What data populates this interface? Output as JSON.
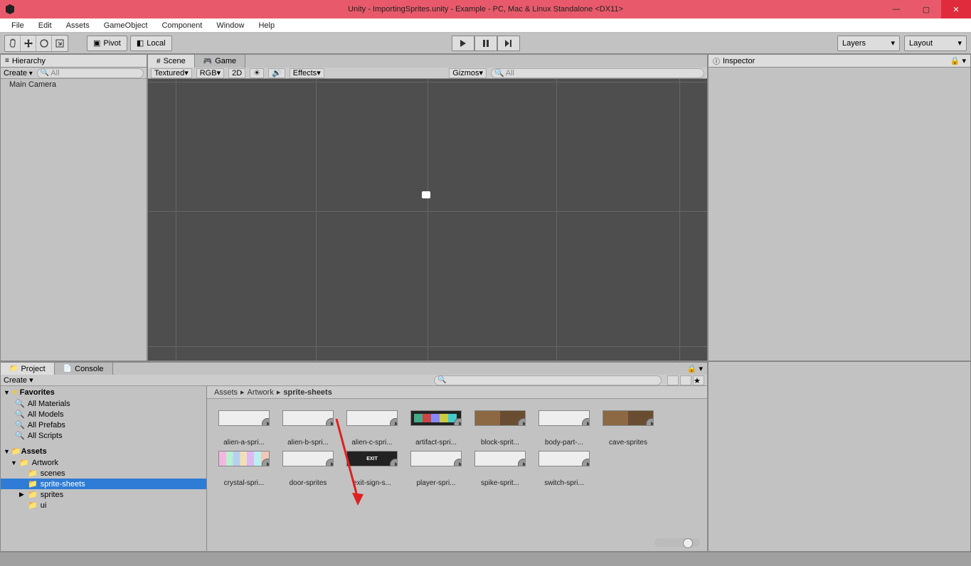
{
  "title": "Unity - ImportingSprites.unity - Example - PC, Mac & Linux Standalone <DX11>",
  "menu": [
    "File",
    "Edit",
    "Assets",
    "GameObject",
    "Component",
    "Window",
    "Help"
  ],
  "toolbar": {
    "pivot": "Pivot",
    "local": "Local",
    "layers": "Layers",
    "layout": "Layout"
  },
  "tabs": {
    "hierarchy": "Hierarchy",
    "scene": "Scene",
    "game": "Game",
    "inspector": "Inspector",
    "project": "Project",
    "console": "Console"
  },
  "hierarchy": {
    "create": "Create",
    "searchPH": "All",
    "items": [
      "Main Camera"
    ]
  },
  "sceneBar": {
    "shading": "Textured",
    "rgb": "RGB",
    "twoD": "2D",
    "effects": "Effects",
    "gizmos": "Gizmos",
    "searchPH": "All"
  },
  "project": {
    "create": "Create",
    "favHeader": "Favorites",
    "favs": [
      "All Materials",
      "All Models",
      "All Prefabs",
      "All Scripts"
    ],
    "assetsHeader": "Assets",
    "folders": [
      {
        "name": "Artwork",
        "open": true,
        "children": [
          {
            "name": "scenes"
          },
          {
            "name": "sprite-sheets",
            "selected": true
          },
          {
            "name": "sprites",
            "hasChildren": true
          },
          {
            "name": "ui"
          }
        ]
      }
    ],
    "breadcrumb": [
      "Assets",
      "Artwork",
      "sprite-sheets"
    ],
    "assets": [
      "alien-a-spri...",
      "alien-b-spri...",
      "alien-c-spri...",
      "artifact-spri...",
      "block-sprit...",
      "body-part-...",
      "cave-sprites",
      "crystal-spri...",
      "door-sprites",
      "exit-sign-s...",
      "player-spri...",
      "spike-sprit...",
      "switch-spri..."
    ]
  }
}
